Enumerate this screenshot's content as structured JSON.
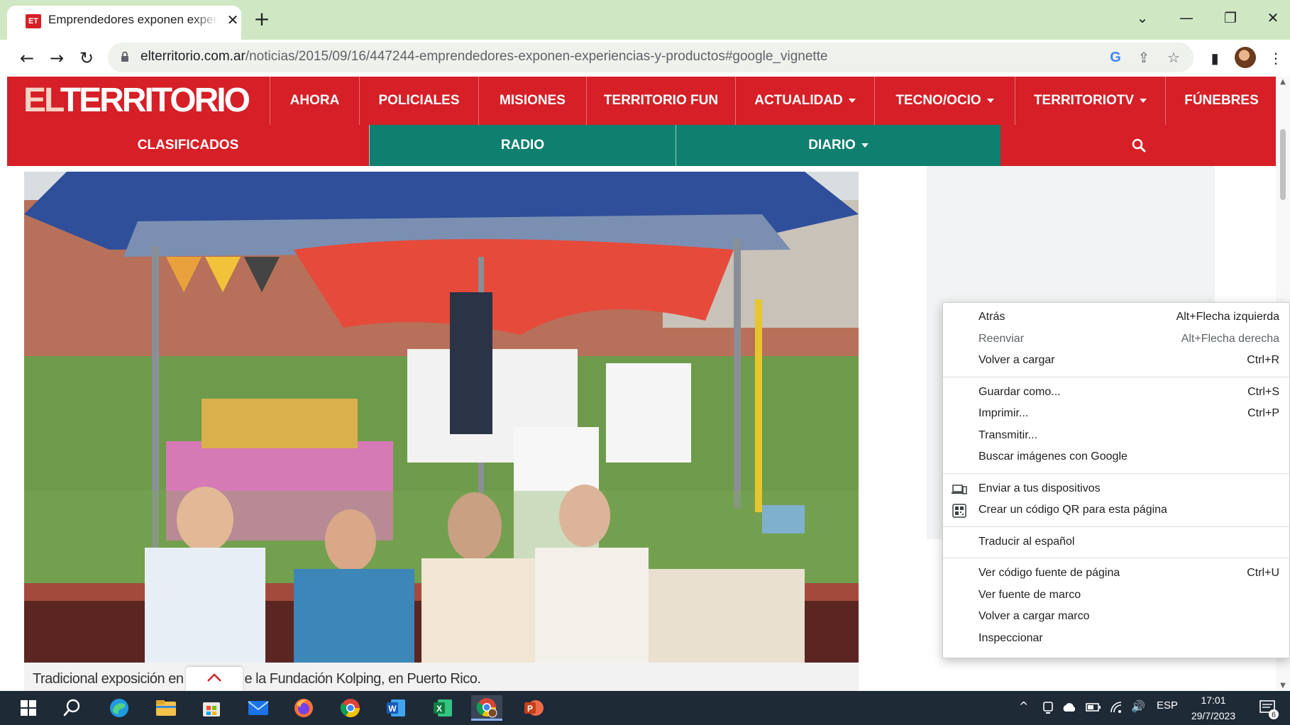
{
  "browser": {
    "tab": {
      "title": "Emprendedores exponen experiencias y productos",
      "favicon_text": "ET",
      "close_glyph": "✕"
    },
    "new_tab_glyph": "+",
    "window_controls": {
      "dropdown": "⌄",
      "minimize": "—",
      "restore": "❐",
      "close": "✕"
    },
    "nav": {
      "back": "←",
      "forward": "→",
      "reload": "↻"
    },
    "url": {
      "host": "elterritorio.com.ar",
      "path": "/noticias/2015/09/16/447244-emprendedores-exponen-experiencias-y-productos#google_vignette"
    },
    "omnibox_icons": {
      "google": "G",
      "share": "⇪",
      "bookmark": "☆"
    },
    "toolbar_icons": {
      "sidepanel": "▮",
      "menu": "⋮"
    }
  },
  "site": {
    "logo": {
      "part1": "EL",
      "part2": "TERRITORIO"
    },
    "nav_primary": [
      "AHORA",
      "POLICIALES",
      "MISIONES",
      "TERRITORIO FUN",
      "ACTUALIDAD",
      "TECNO/OCIO",
      "TERRITORIOTV",
      "FÚNEBRES"
    ],
    "nav_primary_dropdowns": [
      false,
      false,
      false,
      false,
      true,
      true,
      true,
      false
    ],
    "nav_secondary": [
      "CLASIFICADOS",
      "RADIO",
      "DIARIO"
    ],
    "caption": {
      "before": "Tradicional exposición en",
      "after": "e la Fundación Kolping, en Puerto Rico."
    },
    "colors": {
      "brand_red": "#d61f26",
      "teal": "#0f7f6f"
    }
  },
  "context_menu": {
    "groups": [
      [
        {
          "label": "Atrás",
          "shortcut": "Alt+Flecha izquierda",
          "disabled": false
        },
        {
          "label": "Reenviar",
          "shortcut": "Alt+Flecha derecha",
          "disabled": true
        },
        {
          "label": "Volver a cargar",
          "shortcut": "Ctrl+R",
          "disabled": false
        }
      ],
      [
        {
          "label": "Guardar como...",
          "shortcut": "Ctrl+S",
          "disabled": false
        },
        {
          "label": "Imprimir...",
          "shortcut": "Ctrl+P",
          "disabled": false
        },
        {
          "label": "Transmitir...",
          "shortcut": "",
          "disabled": false
        },
        {
          "label": "Buscar imágenes con Google",
          "shortcut": "",
          "disabled": false
        }
      ],
      [
        {
          "label": "Enviar a tus dispositivos",
          "shortcut": "",
          "disabled": false,
          "icon": "devices-icon"
        },
        {
          "label": "Crear un código QR para esta página",
          "shortcut": "",
          "disabled": false,
          "icon": "qr-code-icon"
        }
      ],
      [
        {
          "label": "Traducir al español",
          "shortcut": "",
          "disabled": false
        }
      ],
      [
        {
          "label": "Ver código fuente de página",
          "shortcut": "Ctrl+U",
          "disabled": false
        },
        {
          "label": "Ver fuente de marco",
          "shortcut": "",
          "disabled": false
        },
        {
          "label": "Volver a cargar marco",
          "shortcut": "",
          "disabled": false
        },
        {
          "label": "Inspeccionar",
          "shortcut": "",
          "disabled": false
        }
      ]
    ]
  },
  "taskbar": {
    "apps": [
      "start-icon",
      "search-icon",
      "edge-icon",
      "file-explorer-icon",
      "store-icon",
      "mail-icon",
      "firefox-icon",
      "chrome-icon",
      "word-icon",
      "excel-icon",
      "chrome-profile-icon",
      "powerpoint-icon"
    ],
    "tray": {
      "chevron": "^",
      "language": "ESP",
      "volume": "🔊",
      "notification_count": "6"
    },
    "clock": {
      "time": "17:01",
      "date": "29/7/2023"
    }
  }
}
